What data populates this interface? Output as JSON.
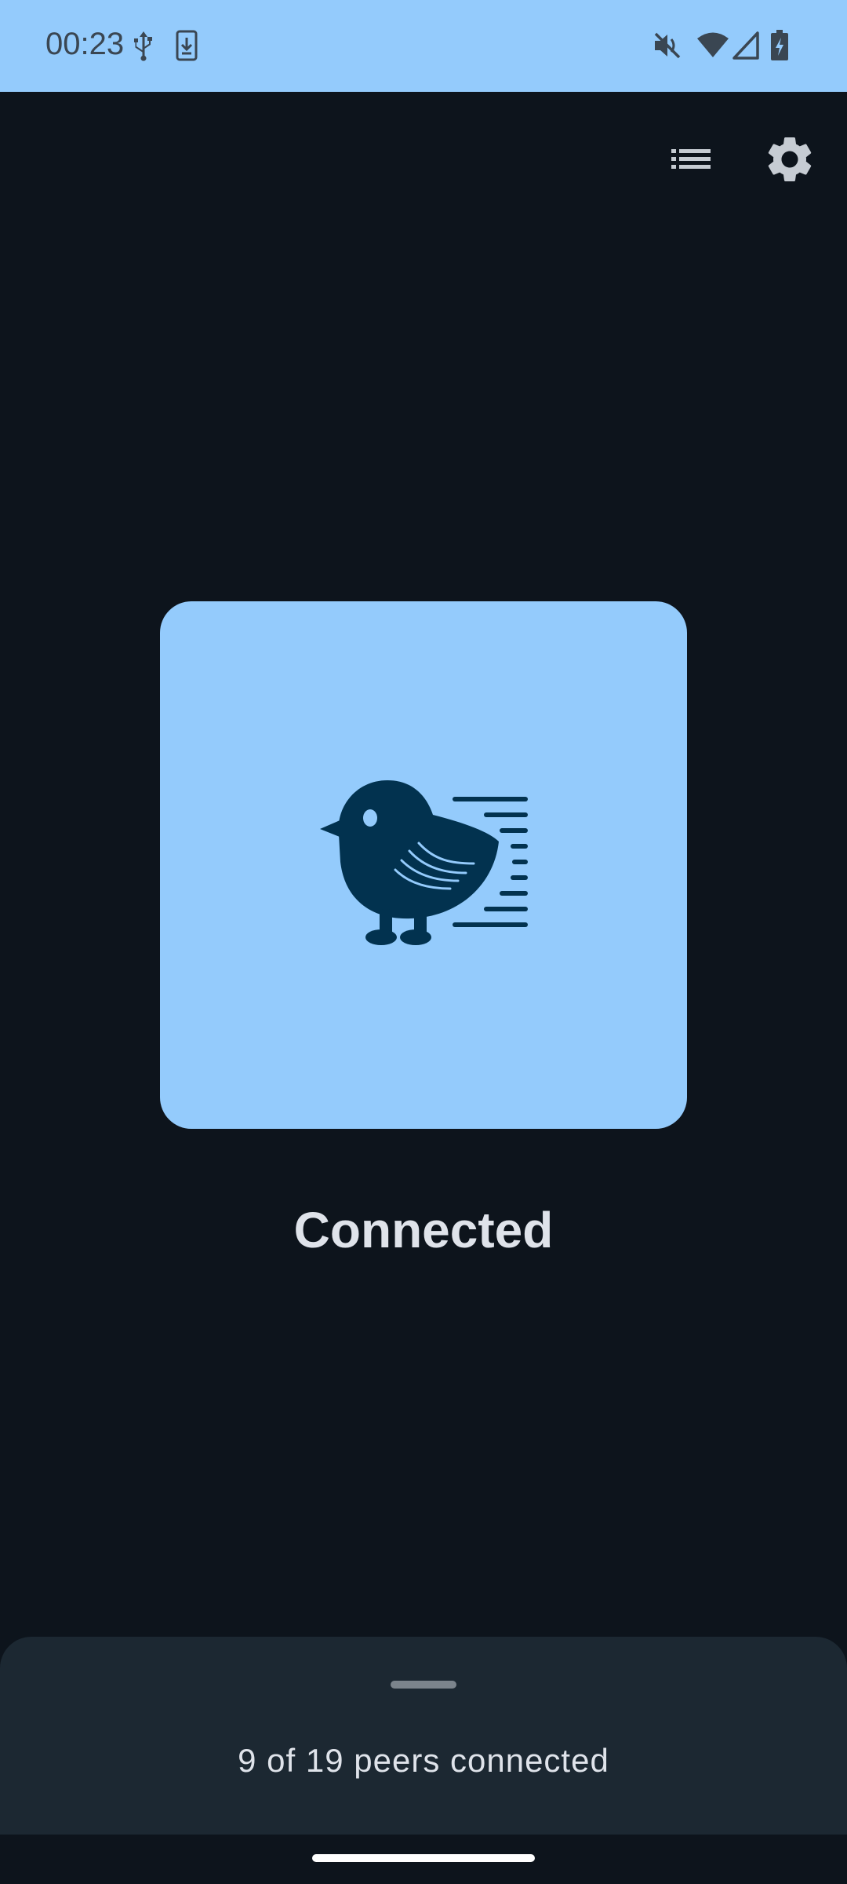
{
  "status_bar": {
    "time": "00:23",
    "background": "#94cbfc",
    "left_icons": [
      "usb-icon",
      "download-icon"
    ],
    "right_icons": [
      "mute-icon",
      "wifi-icon",
      "signal-icon",
      "battery-charging-icon"
    ]
  },
  "toolbar": {
    "icons": [
      "list-icon",
      "gear-icon"
    ]
  },
  "hero": {
    "icon": "bird-icon",
    "card_color": "#94cbfc",
    "icon_color": "#02324f"
  },
  "main": {
    "status_title": "Connected"
  },
  "bottom_sheet": {
    "peers_text": "9 of 19 peers connected"
  },
  "colors": {
    "background": "#0d141c",
    "sheet": "#1c2832",
    "text": "#dfe3ea"
  }
}
